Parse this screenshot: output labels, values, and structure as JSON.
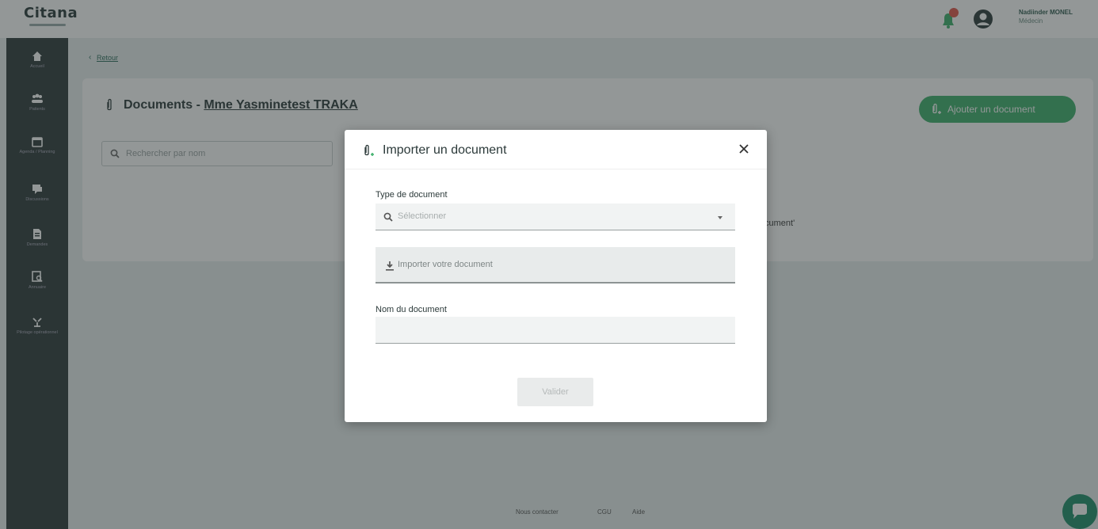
{
  "app": {
    "logo": "Citana"
  },
  "header": {
    "user_name": "Nadiinder MONEL",
    "user_role": "Médecin"
  },
  "sidebar": {
    "items": [
      {
        "label": "Accueil",
        "icon": "home-icon"
      },
      {
        "label": "Patients",
        "icon": "patients-icon"
      },
      {
        "label": "Agenda / Planning",
        "icon": "calendar-icon"
      },
      {
        "label": "Discussions",
        "icon": "chat-icon"
      },
      {
        "label": "Demandes",
        "icon": "request-icon"
      },
      {
        "label": "Annuaire",
        "icon": "directory-icon"
      },
      {
        "label": "Pilotage opérationnel",
        "icon": "pilot-icon"
      }
    ]
  },
  "main": {
    "back_label": "Retour",
    "title_prefix": "Documents - ",
    "patient_name": "Mme Yasminetest TRAKA",
    "add_button_label": "Ajouter un document",
    "search_placeholder": "Rechercher par nom",
    "empty_hint_fragment": "cument'"
  },
  "modal": {
    "title": "Importer un document",
    "type_label": "Type de document",
    "type_placeholder": "Sélectionner",
    "upload_label": "Importer votre document",
    "name_label": "Nom du document",
    "name_value": "",
    "submit_label": "Valider"
  },
  "footer": {
    "links": [
      "Nous contacter",
      "CGU",
      "Aide"
    ]
  },
  "colors": {
    "accent": "#3fb06c",
    "sidebar": "#2f3a3a",
    "notification": "#e0564a"
  }
}
